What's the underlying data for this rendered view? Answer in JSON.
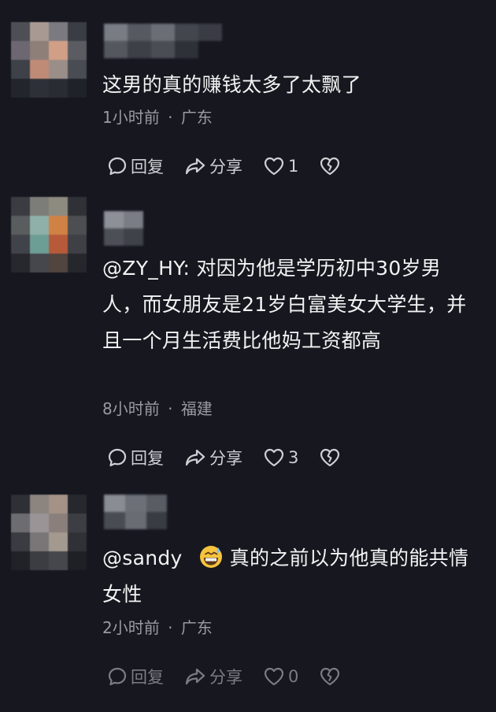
{
  "comments": [
    {
      "text": "这男的真的赚钱太多了太飘了",
      "time": "1小时前",
      "location": "广东",
      "reply_label": "回复",
      "share_label": "分享",
      "like_count": "1"
    },
    {
      "mention": "@ZY_HY:",
      "text": "对因为他是学历初中30岁男人，而女朋友是21岁白富美女大学生，并且一个月生活费比他妈工资都高",
      "time": "8小时前",
      "location": "福建",
      "reply_label": "回复",
      "share_label": "分享",
      "like_count": "3"
    },
    {
      "mention": "@sandy",
      "emoji": "grinning-sweat-emoji",
      "text": "真的之前以为他真的能共情女性",
      "time": "2小时前",
      "location": "广东",
      "reply_label": "回复",
      "share_label": "分享",
      "like_count": "0"
    }
  ],
  "meta_separator": "·",
  "colors": {
    "background": "#16171f",
    "text": "#f3f3f3",
    "meta": "#9a9ba2",
    "action": "#cfd0d4"
  }
}
